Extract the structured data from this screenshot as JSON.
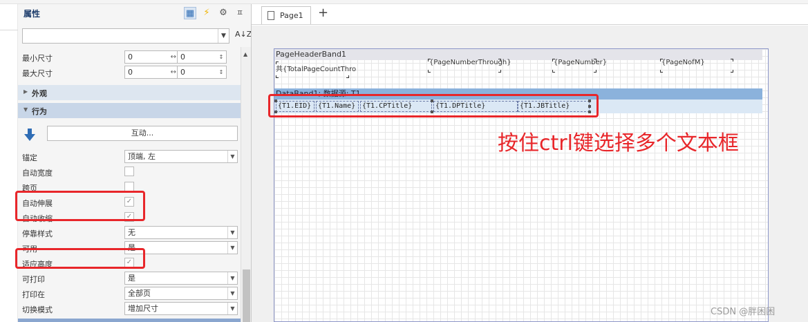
{
  "panel": {
    "title": "属性",
    "object_combo_value": "",
    "sort_label": "A↓Z",
    "sections": {
      "appearance": "外观",
      "behavior": "行为"
    },
    "size_rows": [
      {
        "label": "最小尺寸",
        "w": "0",
        "h": "0"
      },
      {
        "label": "最大尺寸",
        "w": "0",
        "h": "0"
      }
    ],
    "interaction_button": "互动...",
    "rows": [
      {
        "label": "锚定",
        "value": "顶端, 左",
        "kind": "dropdown"
      },
      {
        "label": "自动宽度",
        "checked": false,
        "kind": "checkbox"
      },
      {
        "label": "跨页",
        "checked": false,
        "kind": "checkbox"
      },
      {
        "label": "自动伸展",
        "checked": true,
        "kind": "checkbox"
      },
      {
        "label": "自动收缩",
        "checked": true,
        "kind": "checkbox"
      },
      {
        "label": "停靠样式",
        "value": "无",
        "kind": "dropdown"
      },
      {
        "label": "可用",
        "value": "是",
        "kind": "dropdown"
      },
      {
        "label": "适应高度",
        "checked": true,
        "kind": "checkbox"
      },
      {
        "label": "可打印",
        "value": "是",
        "kind": "dropdown"
      },
      {
        "label": "打印在",
        "value": "全部页",
        "kind": "dropdown"
      },
      {
        "label": "切换模式",
        "value": "增加尺寸",
        "kind": "dropdown"
      }
    ]
  },
  "designer": {
    "tab_label": "Page1",
    "add_tab": "+",
    "header_band": {
      "title": "PageHeaderBand1",
      "fields": [
        "共{TotalPageCountThro",
        "{PageNumberThrough}",
        "{PageNumber}",
        "{PageNofM}"
      ]
    },
    "data_band": {
      "title": "DataBand1; 数据源: T1",
      "fields": [
        "{T1.EID}",
        "{T1.Name}",
        "{T1.CPTitle}",
        "{T1.DPTitle}",
        "{T1.JBTitle}"
      ]
    }
  },
  "annotation": "按住ctrl键选择多个文本框",
  "watermark": "CSDN @胖困困",
  "colors": {
    "highlight": "#e8262a",
    "accent_blue": "#8bb2dc",
    "section_behavior": "#c8d6e8"
  }
}
